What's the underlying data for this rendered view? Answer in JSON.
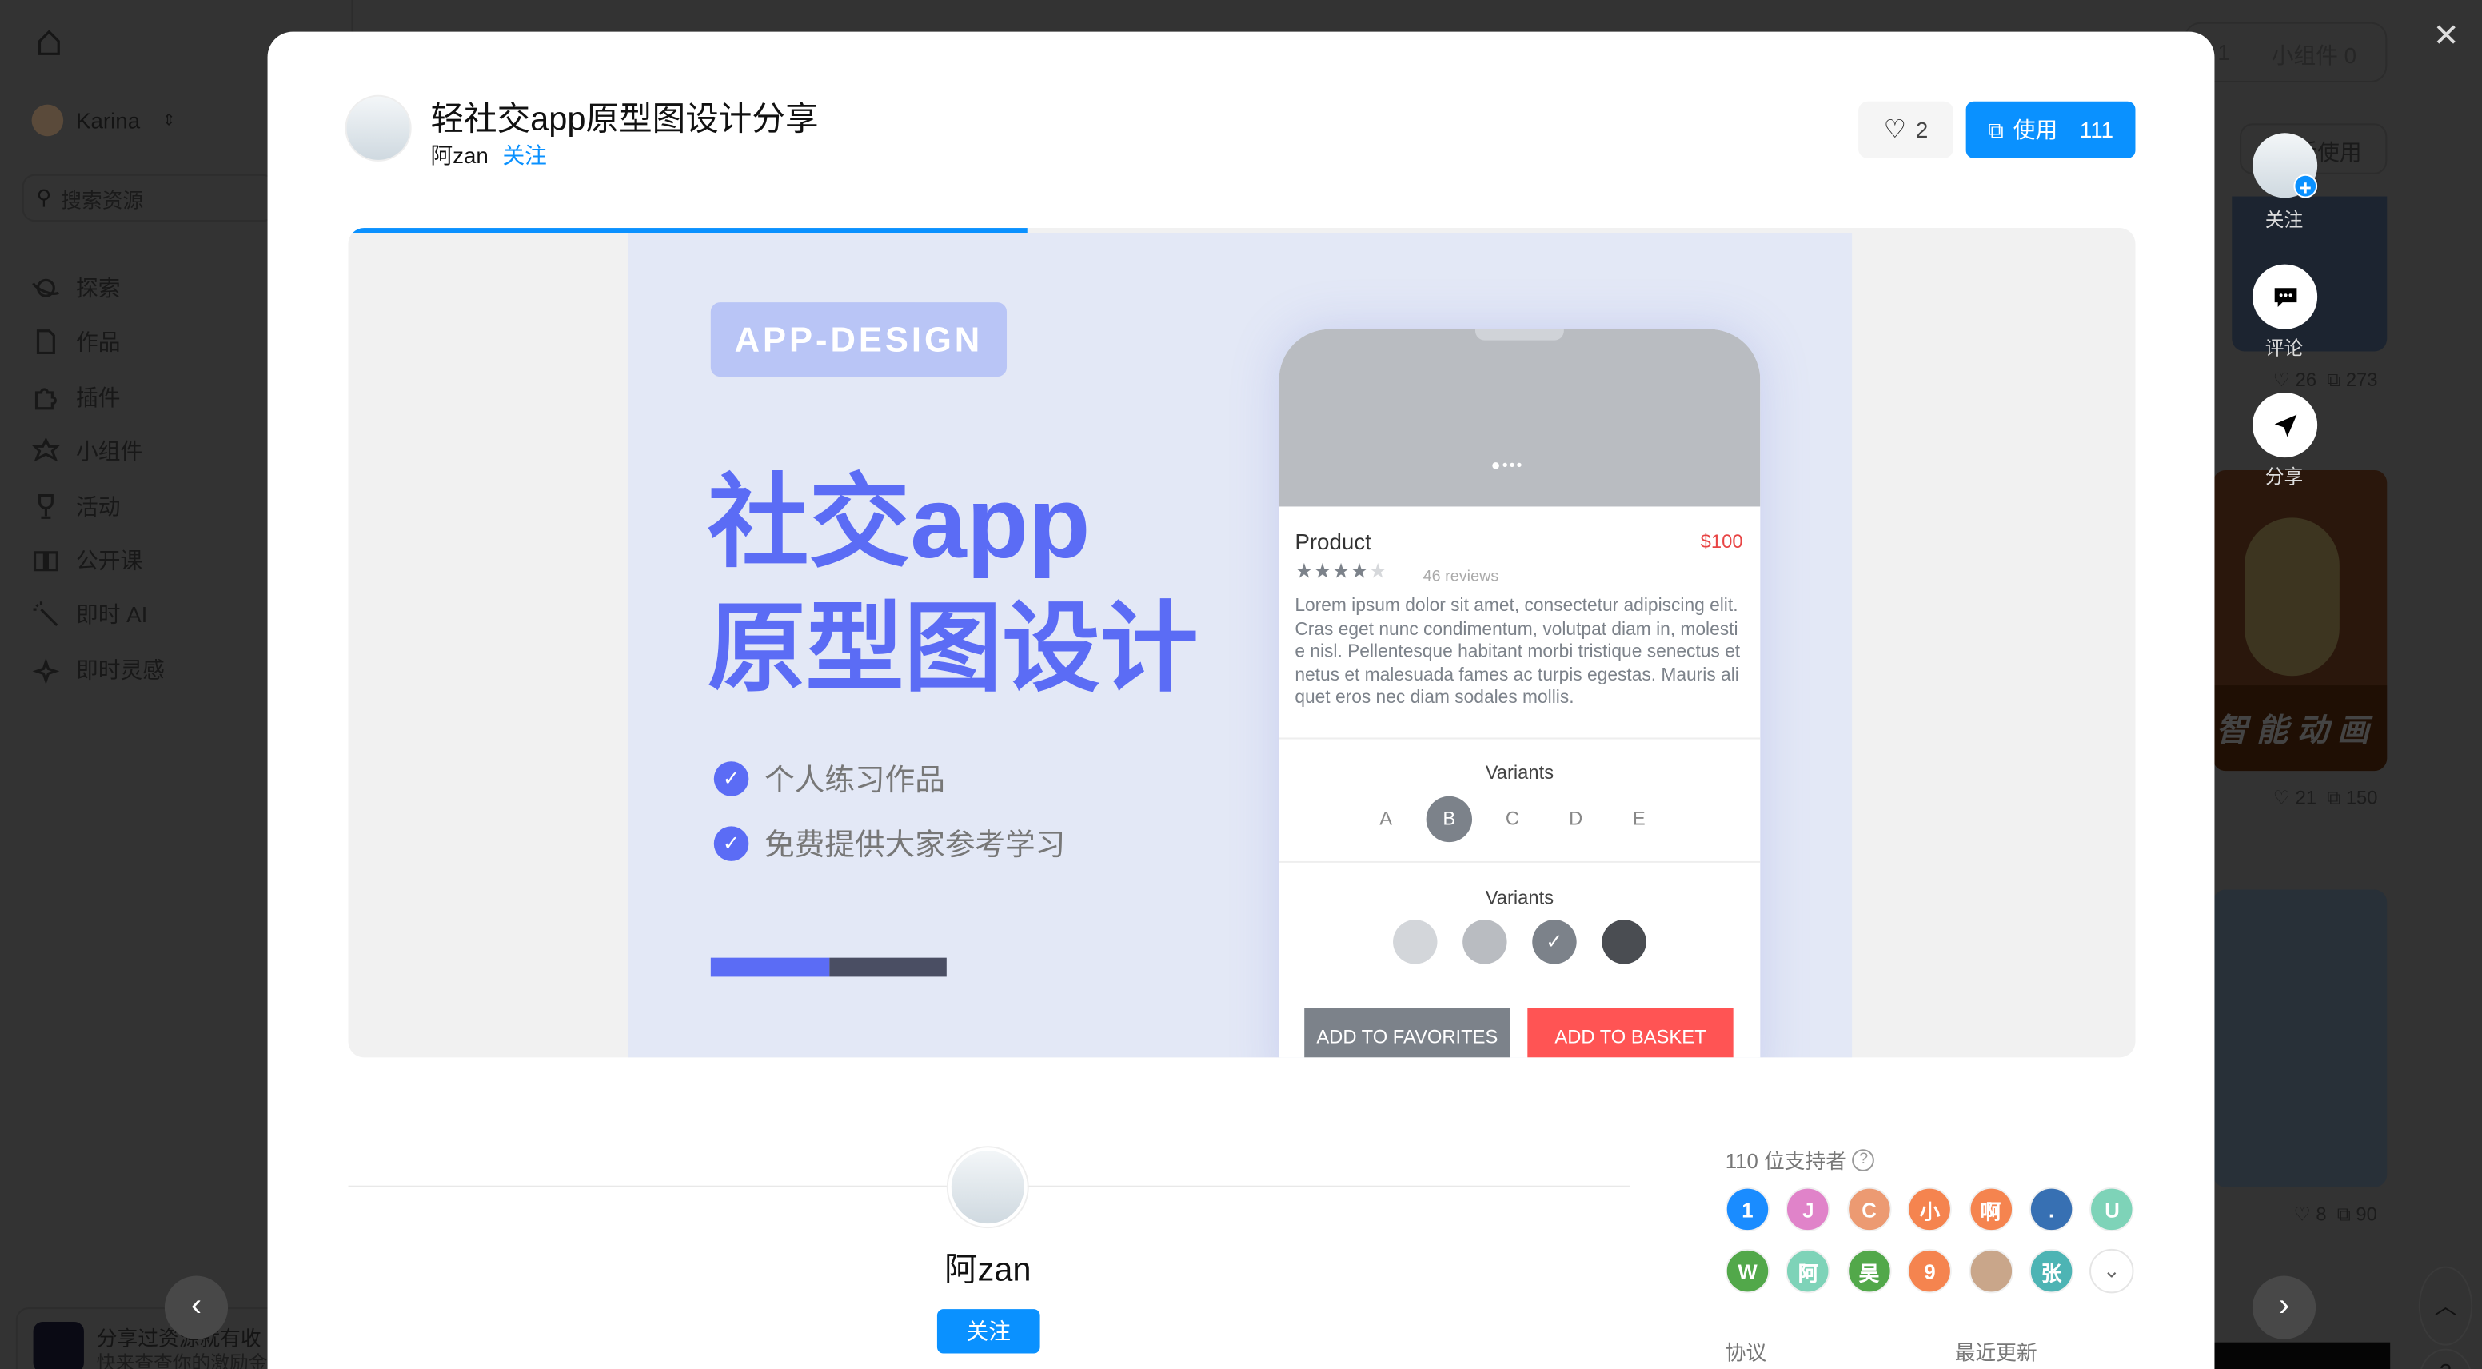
{
  "sidebar": {
    "user": "Karina",
    "search_placeholder": "搜索资源",
    "items": [
      {
        "label": "探索",
        "icon": "planet-icon"
      },
      {
        "label": "作品",
        "icon": "file-icon"
      },
      {
        "label": "插件",
        "icon": "puzzle-icon"
      },
      {
        "label": "小组件",
        "icon": "widget-star-icon"
      },
      {
        "label": "活动",
        "icon": "trophy-icon"
      },
      {
        "label": "公开课",
        "icon": "book-icon"
      },
      {
        "label": "即时 AI",
        "icon": "magic-wand-icon"
      },
      {
        "label": "即时灵感",
        "icon": "sparkle-icon"
      }
    ],
    "promo": {
      "title": "分享过资源就有收",
      "subtitle": "快来查查你的激励金"
    }
  },
  "background": {
    "tab_count": "1",
    "tab_widgets": "小组件 0",
    "sort_select": "最近使用",
    "cards": [
      {
        "likes": "26",
        "uses": "273"
      },
      {
        "likes": "21",
        "uses": "150",
        "banner": "智 能 动 画"
      },
      {
        "likes": "8",
        "uses": "90"
      }
    ]
  },
  "modal": {
    "title": "轻社交app原型图设计分享",
    "author": "阿zan",
    "follow": "关注",
    "likes": "2",
    "use_label": "使用",
    "use_count": "111",
    "progress": 0.38,
    "preview": {
      "badge": "APP-DESIGN",
      "headline1": "社交app",
      "headline2": "原型图设计",
      "bullets": [
        "个人练习作品",
        "免费提供大家参考学习"
      ],
      "product": "Product",
      "price": "$100",
      "rating": 4,
      "reviews": "46 reviews",
      "description": "Lorem ipsum dolor sit amet, consectetur adipiscing elit. Cras eget nunc condimentum, volutpat diam in, molestie nisl. Pellentesque habitant morbi tristique senectus et netus et malesuada fames ac turpis egestas. Mauris aliquet eros nec diam sodales mollis.",
      "variants_label": "Variants",
      "variants": [
        "A",
        "B",
        "C",
        "D",
        "E"
      ],
      "selected_variant": "B",
      "colors_label": "Variants",
      "colors": [
        "#d3d6da",
        "#b9bcc1",
        "#7c828a",
        "#4a4d52"
      ],
      "fav_button": "ADD TO FAVORITES",
      "basket_button": "ADD TO BASKET"
    },
    "author_card": {
      "name": "阿zan",
      "follow": "关注"
    },
    "supporters": {
      "title": "110 位支持者",
      "avatars": [
        {
          "t": "1",
          "c": "#1a8cff"
        },
        {
          "t": "J",
          "c": "#e083c9"
        },
        {
          "t": "C",
          "c": "#ec9a72"
        },
        {
          "t": "小",
          "c": "#f5844f"
        },
        {
          "t": "啊",
          "c": "#f5844f"
        },
        {
          "t": ".",
          "c": "#3770b3"
        },
        {
          "t": "U",
          "c": "#7ed3b8"
        },
        {
          "t": "W",
          "c": "#52a84a"
        },
        {
          "t": "阿",
          "c": "#7ed3b8"
        },
        {
          "t": "吴",
          "c": "#52a84a"
        },
        {
          "t": "9",
          "c": "#f5844f"
        },
        {
          "t": "",
          "c": "#c9a68a"
        },
        {
          "t": "张",
          "c": "#4db4b4"
        }
      ]
    },
    "meta": {
      "license": "协议",
      "updated": "最近更新"
    }
  },
  "actions": {
    "follow": "关注",
    "comment": "评论",
    "share": "分享"
  },
  "colors": {
    "accent": "#0a91ff",
    "headline": "#5b6cf5",
    "danger": "#ff5454"
  }
}
